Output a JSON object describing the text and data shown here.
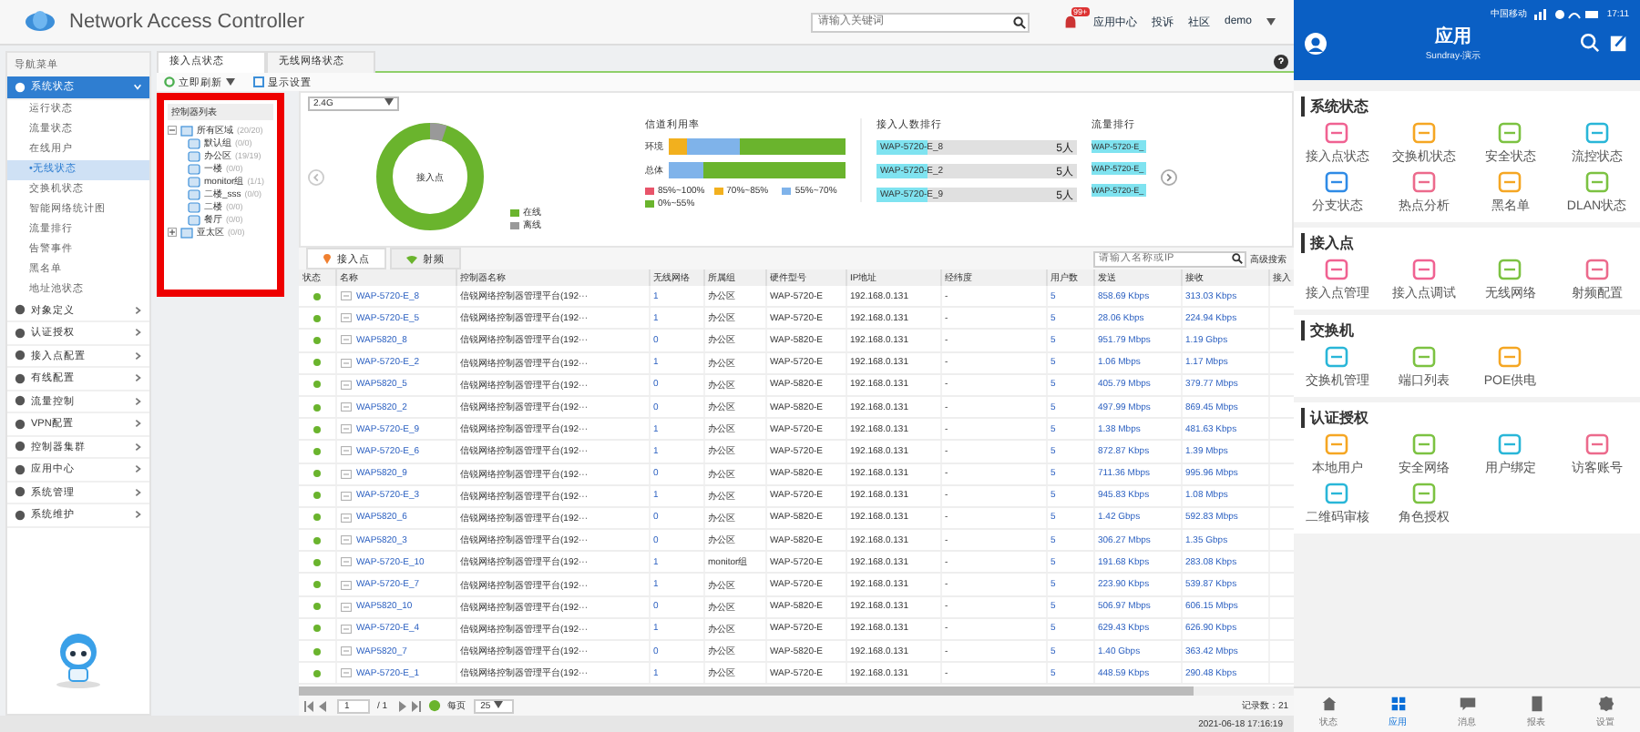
{
  "header": {
    "title": "Network Access Controller",
    "search": {
      "placeholder": "请输入关键词"
    },
    "badge": "99+",
    "links": [
      "应用中心",
      "投诉",
      "社区"
    ],
    "user": "demo"
  },
  "nav": {
    "title": "导航菜单",
    "groups": [
      {
        "label": "系统状态",
        "selected": true,
        "expanded": true,
        "children": [
          {
            "label": "运行状态",
            "selected": false
          },
          {
            "label": "流量状态",
            "selected": false
          },
          {
            "label": "在线用户",
            "selected": false
          },
          {
            "label": "•无线状态",
            "selected": true
          },
          {
            "label": "交换机状态",
            "selected": false
          },
          {
            "label": "智能网络统计图",
            "selected": false
          },
          {
            "label": "流量排行",
            "selected": false
          },
          {
            "label": "告警事件",
            "selected": false
          },
          {
            "label": "黑名单",
            "selected": false
          },
          {
            "label": "地址池状态",
            "selected": false
          }
        ]
      },
      {
        "label": "对象定义",
        "selected": false,
        "expanded": false
      },
      {
        "label": "认证授权",
        "selected": false,
        "expanded": false
      },
      {
        "label": "接入点配置",
        "selected": false,
        "expanded": false
      },
      {
        "label": "有线配置",
        "selected": false,
        "expanded": false
      },
      {
        "label": "流量控制",
        "selected": false,
        "expanded": false
      },
      {
        "label": "VPN配置",
        "selected": false,
        "expanded": false
      },
      {
        "label": "控制器集群",
        "selected": false,
        "expanded": false
      },
      {
        "label": "应用中心",
        "selected": false,
        "expanded": false
      },
      {
        "label": "系统管理",
        "selected": false,
        "expanded": false
      },
      {
        "label": "系统维护",
        "selected": false,
        "expanded": false
      }
    ]
  },
  "page_tabs": [
    {
      "label": "接入点状态",
      "selected": true
    },
    {
      "label": "无线网络状态",
      "selected": false
    }
  ],
  "toolbar": [
    "立即刷新",
    "显示设置"
  ],
  "tree": {
    "title": "控制器列表",
    "nodes": [
      {
        "label": "所有区域",
        "count": "(20/20)",
        "expanded": true,
        "children": [
          {
            "label": "默认组",
            "count": "(0/0)"
          },
          {
            "label": "办公区",
            "count": "(19/19)"
          },
          {
            "label": "一楼",
            "count": "(0/0)"
          },
          {
            "label": "monitor组",
            "count": "(1/1)"
          },
          {
            "label": "二楼_sss",
            "count": "(0/0)"
          },
          {
            "label": "二楼",
            "count": "(0/0)"
          },
          {
            "label": "餐厅",
            "count": "(0/0)"
          }
        ]
      },
      {
        "label": "亚太区",
        "count": "(0/0)",
        "expanded": false
      }
    ]
  },
  "band_select": "2.4G",
  "donut": {
    "center": "接入点",
    "legend": [
      {
        "label": "在线",
        "color": "#6ab42d"
      },
      {
        "label": "离线",
        "color": "#999999"
      }
    ]
  },
  "channel": {
    "title": "信道利用率",
    "rows": [
      "环境",
      "总体"
    ],
    "legend": [
      {
        "label": "85%~100%",
        "color": "#e8546a"
      },
      {
        "label": "70%~85%",
        "color": "#f2b01e"
      },
      {
        "label": "55%~70%",
        "color": "#7fb3ea"
      },
      {
        "label": "0%~55%",
        "color": "#6ab42d"
      }
    ]
  },
  "rank_users": {
    "title": "接入人数排行",
    "items": [
      {
        "name": "WAP-5720-E_8",
        "value": "5人",
        "level": 0.25
      },
      {
        "name": "WAP-5720-E_2",
        "value": "5人",
        "level": 0.25
      },
      {
        "name": "WAP-5720-E_9",
        "value": "5人",
        "level": 0.25
      }
    ]
  },
  "rank_traffic": {
    "title": "流量排行",
    "items": [
      {
        "name": "WAP-5720-E_"
      },
      {
        "name": "WAP-5720-E_"
      },
      {
        "name": "WAP-5720-E_"
      }
    ]
  },
  "table": {
    "tabs": [
      {
        "label": "接入点",
        "selected": true
      },
      {
        "label": "射频",
        "selected": false
      }
    ],
    "search": {
      "placeholder": "请输入名称或IP"
    },
    "advanced": "高级搜索",
    "columns": [
      "状态",
      "名称",
      "控制器名称",
      "无线网络",
      "所属组",
      "硬件型号",
      "IP地址",
      "经纬度",
      "用户数",
      "发送",
      "接收",
      "接入"
    ],
    "rows": [
      {
        "online": true,
        "name": "WAP-5720-E_8",
        "controller": "信锐网络控制器管理平台(192···",
        "wlan": "1",
        "group": "办公区",
        "model": "WAP-5720-E",
        "ip": "192.168.0.131",
        "location": "-",
        "users": "5",
        "sent": "858.69 Kbps",
        "received": "313.03 Kbps"
      },
      {
        "online": true,
        "name": "WAP-5720-E_5",
        "controller": "信锐网络控制器管理平台(192···",
        "wlan": "1",
        "group": "办公区",
        "model": "WAP-5720-E",
        "ip": "192.168.0.131",
        "location": "-",
        "users": "5",
        "sent": "28.06 Kbps",
        "received": "224.94 Kbps"
      },
      {
        "online": true,
        "name": "WAP5820_8",
        "controller": "信锐网络控制器管理平台(192···",
        "wlan": "0",
        "group": "办公区",
        "model": "WAP-5820-E",
        "ip": "192.168.0.131",
        "location": "-",
        "users": "5",
        "sent": "951.79 Mbps",
        "received": "1.19 Gbps"
      },
      {
        "online": true,
        "name": "WAP-5720-E_2",
        "controller": "信锐网络控制器管理平台(192···",
        "wlan": "1",
        "group": "办公区",
        "model": "WAP-5720-E",
        "ip": "192.168.0.131",
        "location": "-",
        "users": "5",
        "sent": "1.06 Mbps",
        "received": "1.17 Mbps"
      },
      {
        "online": true,
        "name": "WAP5820_5",
        "controller": "信锐网络控制器管理平台(192···",
        "wlan": "0",
        "group": "办公区",
        "model": "WAP-5820-E",
        "ip": "192.168.0.131",
        "location": "-",
        "users": "5",
        "sent": "405.79 Mbps",
        "received": "379.77 Mbps"
      },
      {
        "online": true,
        "name": "WAP5820_2",
        "controller": "信锐网络控制器管理平台(192···",
        "wlan": "0",
        "group": "办公区",
        "model": "WAP-5820-E",
        "ip": "192.168.0.131",
        "location": "-",
        "users": "5",
        "sent": "497.99 Mbps",
        "received": "869.45 Mbps"
      },
      {
        "online": true,
        "name": "WAP-5720-E_9",
        "controller": "信锐网络控制器管理平台(192···",
        "wlan": "1",
        "group": "办公区",
        "model": "WAP-5720-E",
        "ip": "192.168.0.131",
        "location": "-",
        "users": "5",
        "sent": "1.38 Mbps",
        "received": "481.63 Kbps"
      },
      {
        "online": true,
        "name": "WAP-5720-E_6",
        "controller": "信锐网络控制器管理平台(192···",
        "wlan": "1",
        "group": "办公区",
        "model": "WAP-5720-E",
        "ip": "192.168.0.131",
        "location": "-",
        "users": "5",
        "sent": "872.87 Kbps",
        "received": "1.39 Mbps"
      },
      {
        "online": true,
        "name": "WAP5820_9",
        "controller": "信锐网络控制器管理平台(192···",
        "wlan": "0",
        "group": "办公区",
        "model": "WAP-5820-E",
        "ip": "192.168.0.131",
        "location": "-",
        "users": "5",
        "sent": "711.36 Mbps",
        "received": "995.96 Mbps"
      },
      {
        "online": true,
        "name": "WAP-5720-E_3",
        "controller": "信锐网络控制器管理平台(192···",
        "wlan": "1",
        "group": "办公区",
        "model": "WAP-5720-E",
        "ip": "192.168.0.131",
        "location": "-",
        "users": "5",
        "sent": "945.83 Kbps",
        "received": "1.08 Mbps"
      },
      {
        "online": true,
        "name": "WAP5820_6",
        "controller": "信锐网络控制器管理平台(192···",
        "wlan": "0",
        "group": "办公区",
        "model": "WAP-5820-E",
        "ip": "192.168.0.131",
        "location": "-",
        "users": "5",
        "sent": "1.42 Gbps",
        "received": "592.83 Mbps"
      },
      {
        "online": true,
        "name": "WAP5820_3",
        "controller": "信锐网络控制器管理平台(192···",
        "wlan": "0",
        "group": "办公区",
        "model": "WAP-5820-E",
        "ip": "192.168.0.131",
        "location": "-",
        "users": "5",
        "sent": "306.27 Mbps",
        "received": "1.35 Gbps"
      },
      {
        "online": true,
        "name": "WAP-5720-E_10",
        "controller": "信锐网络控制器管理平台(192···",
        "wlan": "1",
        "group": "monitor组",
        "model": "WAP-5720-E",
        "ip": "192.168.0.131",
        "location": "-",
        "users": "5",
        "sent": "191.68 Kbps",
        "received": "283.08 Kbps"
      },
      {
        "online": true,
        "name": "WAP-5720-E_7",
        "controller": "信锐网络控制器管理平台(192···",
        "wlan": "1",
        "group": "办公区",
        "model": "WAP-5720-E",
        "ip": "192.168.0.131",
        "location": "-",
        "users": "5",
        "sent": "223.90 Kbps",
        "received": "539.87 Kbps"
      },
      {
        "online": true,
        "name": "WAP5820_10",
        "controller": "信锐网络控制器管理平台(192···",
        "wlan": "0",
        "group": "办公区",
        "model": "WAP-5820-E",
        "ip": "192.168.0.131",
        "location": "-",
        "users": "5",
        "sent": "506.97 Mbps",
        "received": "606.15 Mbps"
      },
      {
        "online": true,
        "name": "WAP-5720-E_4",
        "controller": "信锐网络控制器管理平台(192···",
        "wlan": "1",
        "group": "办公区",
        "model": "WAP-5720-E",
        "ip": "192.168.0.131",
        "location": "-",
        "users": "5",
        "sent": "629.43 Kbps",
        "received": "626.90 Kbps"
      },
      {
        "online": true,
        "name": "WAP5820_7",
        "controller": "信锐网络控制器管理平台(192···",
        "wlan": "0",
        "group": "办公区",
        "model": "WAP-5820-E",
        "ip": "192.168.0.131",
        "location": "-",
        "users": "5",
        "sent": "1.40 Gbps",
        "received": "363.42 Mbps"
      },
      {
        "online": true,
        "name": "WAP-5720-E_1",
        "controller": "信锐网络控制器管理平台(192···",
        "wlan": "1",
        "group": "办公区",
        "model": "WAP-5720-E",
        "ip": "192.168.0.131",
        "location": "-",
        "users": "5",
        "sent": "448.59 Kbps",
        "received": "290.48 Kbps"
      }
    ]
  },
  "pagination": {
    "page": "1",
    "total": "/ 1",
    "per_page_label": "每页",
    "per_page": "25",
    "records": "记录数：21"
  },
  "timestamp": "2021-06-18 17:16:19",
  "phone": {
    "carrier": "中国移动",
    "time": "17:11",
    "title": "应用",
    "subtitle": "Sundray-演示",
    "sections": [
      {
        "title": "系统状态",
        "items": [
          {
            "label": "接入点状态",
            "color": "#f06292"
          },
          {
            "label": "交换机状态",
            "color": "#f5a623"
          },
          {
            "label": "安全状态",
            "color": "#7cc242"
          },
          {
            "label": "流控状态",
            "color": "#29b6d8"
          },
          {
            "label": "分支状态",
            "color": "#2f8be6"
          },
          {
            "label": "热点分析",
            "color": "#ec6a8c"
          },
          {
            "label": "黑名单",
            "color": "#f5a623"
          },
          {
            "label": "DLAN状态",
            "color": "#7cc242"
          }
        ]
      },
      {
        "title": "接入点",
        "items": [
          {
            "label": "接入点管理",
            "color": "#f06292"
          },
          {
            "label": "接入点调试",
            "color": "#f06292"
          },
          {
            "label": "无线网络",
            "color": "#7cc242"
          },
          {
            "label": "射频配置",
            "color": "#ec6a8c"
          }
        ]
      },
      {
        "title": "交换机",
        "items": [
          {
            "label": "交换机管理",
            "color": "#29b6d8"
          },
          {
            "label": "端口列表",
            "color": "#7cc242"
          },
          {
            "label": "POE供电",
            "color": "#f5a623"
          }
        ]
      },
      {
        "title": "认证授权",
        "items": [
          {
            "label": "本地用户",
            "color": "#f5a623"
          },
          {
            "label": "安全网络",
            "color": "#7cc242"
          },
          {
            "label": "用户绑定",
            "color": "#29b6d8"
          },
          {
            "label": "访客账号",
            "color": "#ec6a8c"
          },
          {
            "label": "二维码审核",
            "color": "#29b6d8"
          },
          {
            "label": "角色授权",
            "color": "#7cc242"
          }
        ]
      }
    ],
    "tabs": [
      {
        "label": "状态",
        "selected": false
      },
      {
        "label": "应用",
        "selected": true
      },
      {
        "label": "消息",
        "selected": false
      },
      {
        "label": "报表",
        "selected": false
      },
      {
        "label": "设置",
        "selected": false
      }
    ]
  }
}
